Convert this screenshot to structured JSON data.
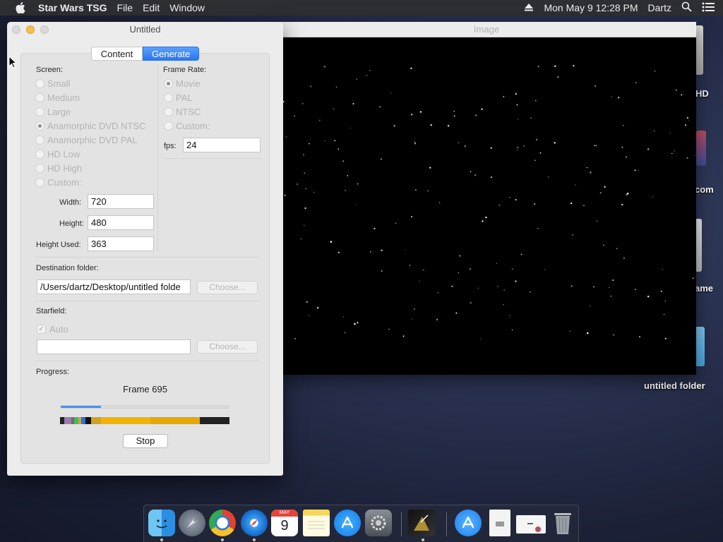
{
  "menubar": {
    "app_name": "Star Wars TSG",
    "menus": [
      "File",
      "Edit",
      "Window"
    ],
    "clock": "Mon May 9  12:28 PM",
    "user": "Dartz"
  },
  "desktop": {
    "labels": [
      "HD",
      "com",
      "ame",
      "untitled folder"
    ]
  },
  "image_window": {
    "title": "Image"
  },
  "main_window": {
    "title": "Untitled",
    "tabs": [
      "Content",
      "Generate"
    ],
    "selected_tab": "Generate",
    "screen": {
      "label": "Screen:",
      "options": [
        "Small",
        "Medium",
        "Large",
        "Anamorphic DVD NTSC",
        "Anamorphic DVD PAL",
        "HD Low",
        "HD High",
        "Custom:"
      ],
      "selected": "Anamorphic DVD NTSC",
      "width_label": "Width:",
      "width_value": "720",
      "height_label": "Height:",
      "height_value": "480",
      "height_used_label": "Height Used:",
      "height_used_value": "363"
    },
    "frame_rate": {
      "label": "Frame Rate:",
      "options": [
        "Movie",
        "PAL",
        "NTSC",
        "Custom:"
      ],
      "selected": "Movie",
      "fps_label": "fps:",
      "fps_value": "24"
    },
    "destination": {
      "label": "Destination folder:",
      "path": "/Users/dartz/Desktop/untitled folde",
      "choose_label": "Choose..."
    },
    "starfield": {
      "label": "Starfield:",
      "auto_label": "Auto",
      "auto_checked": true,
      "field_value": "",
      "choose_label": "Choose..."
    },
    "progress": {
      "label": "Progress:",
      "status": "Frame 695",
      "fraction": 0.24,
      "strip_colors": [
        "#222222",
        "#9c7bb0",
        "#6e6e6e",
        "#3cbf5a",
        "#c9a34a",
        "#2c6fd6",
        "#111111",
        "#d4a020",
        "#f2b400",
        "#e8a800",
        "#222222"
      ],
      "stop_label": "Stop"
    }
  },
  "dock": {
    "icons": [
      "finder-icon",
      "launchpad-icon",
      "chrome-icon",
      "safari-icon",
      "calendar-icon",
      "notes-icon",
      "app-store-icon",
      "system-preferences-icon",
      "star-wars-tsg-icon",
      "applications-folder-icon",
      "document-icon",
      "downloads-icon",
      "trash-icon"
    ],
    "calendar_month": "MAY",
    "calendar_day": "9"
  }
}
